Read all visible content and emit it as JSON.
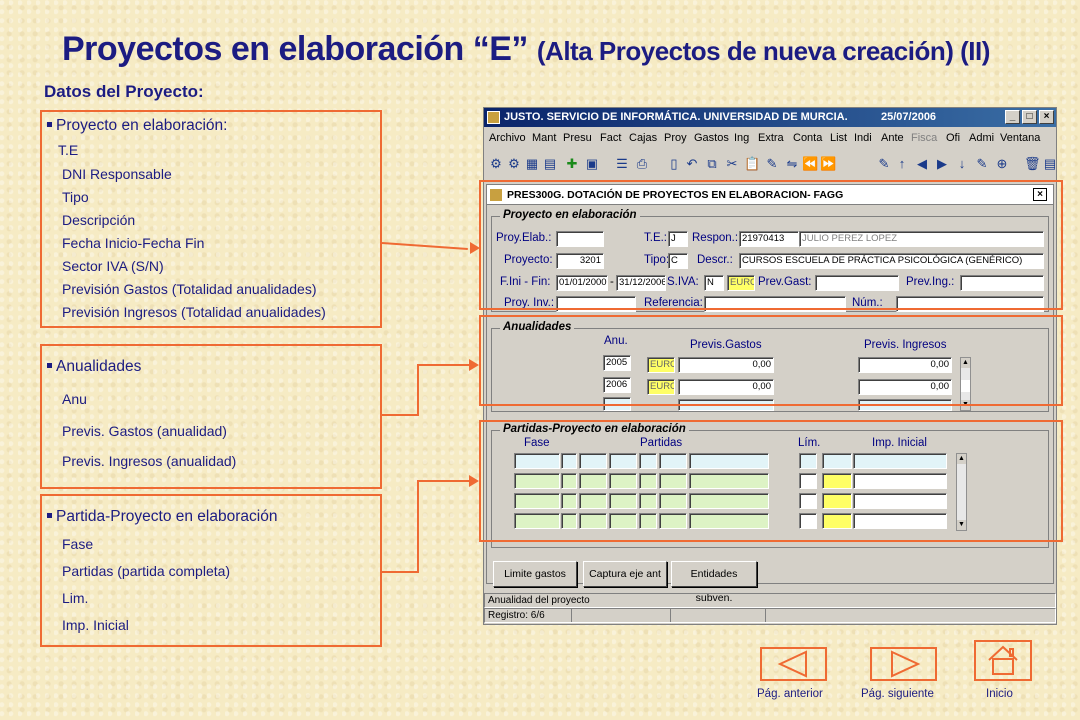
{
  "slide": {
    "title_main": "Proyectos en elaboración “E”",
    "title_sub": "(Alta Proyectos de nueva creación) (II)",
    "section": "Datos del Proyecto:"
  },
  "box1": {
    "heading": "Proyecto en elaboración:",
    "items": [
      "T.E",
      "DNI Responsable",
      "Tipo",
      "Descripción",
      "Fecha Inicio-Fecha Fin",
      "Sector IVA (S/N)",
      "Previsión Gastos (Totalidad anualidades)",
      "Previsión Ingresos (Totalidad anualidades)"
    ]
  },
  "box2": {
    "heading": "Anualidades",
    "items": [
      "Anu",
      "Previs. Gastos (anualidad)",
      "Previs. Ingresos (anualidad)"
    ]
  },
  "box3": {
    "heading": "Partida-Proyecto en elaboración",
    "items": [
      "Fase",
      "Partidas (partida completa)",
      "Lim.",
      "Imp. Inicial"
    ]
  },
  "app": {
    "title": "JUSTO. SERVICIO DE INFORMÁTICA. UNIVERSIDAD DE MURCIA.",
    "date": "25/07/2006",
    "window_buttons": [
      "_",
      "□",
      "×"
    ],
    "menu": [
      "Archivo",
      "Mant",
      "Presu",
      "Fact",
      "Cajas",
      "Proy",
      "Gastos",
      "Ing",
      "Extra",
      "Conta",
      "List",
      "Indi",
      "Ante",
      "Fisca",
      "Ofi",
      "Admi",
      "Ventana"
    ],
    "form_title": "PRES300G. DOTACIÓN DE PROYECTOS EN ELABORACION- FAGG",
    "close": "×",
    "group1": {
      "title": "Proyecto en elaboración",
      "proy_elab_label": "Proy.Elab.:",
      "te_label": "T.E.:",
      "te_value": "J",
      "respon_label": "Respon.:",
      "respon_dni": "21970413",
      "respon_name": "JULIO PEREZ LOPEZ",
      "proyecto_label": "Proyecto:",
      "proyecto_value": "3201",
      "tipo_label": "Tipo:",
      "tipo_value": "C",
      "descr_label": "Descr.:",
      "descr_value": "CURSOS ESCUELA DE PRÁCTICA PSICOLÓGICA (GENÉRICO)",
      "fini_label": "F.Ini - Fin:",
      "fini_value": "01/01/2000",
      "dash": "-",
      "ffin_value": "31/12/2006",
      "siva_label": "S.IVA:",
      "siva_value": "N",
      "currency": "EURO",
      "prevgast_label": "Prev.Gast:",
      "prevgast_value": "",
      "preving_label": "Prev.Ing.:",
      "preving_value": "",
      "proyinv_label": "Proy. Inv.:",
      "proyinv_value": "",
      "referencia_label": "Referencia:",
      "referencia_value": "",
      "num_label": "Núm.:",
      "num_value": ""
    },
    "group2": {
      "title": "Anualidades",
      "col_anu": "Anu.",
      "col_gastos": "Previs.Gastos",
      "col_ingresos": "Previs. Ingresos",
      "rows": [
        {
          "anu": "2005",
          "cur": "EURO",
          "gastos": "0,00",
          "ingresos": "0,00"
        },
        {
          "anu": "2006",
          "cur": "EURO",
          "gastos": "0,00",
          "ingresos": "0,00"
        },
        {
          "anu": "",
          "cur": "",
          "gastos": "",
          "ingresos": ""
        }
      ]
    },
    "group3": {
      "title": "Partidas-Proyecto en elaboración",
      "col_fase": "Fase",
      "col_partidas": "Partidas",
      "col_lim": "Lím.",
      "col_imp": "Imp. Inicial"
    },
    "buttons": {
      "limite": "Limite gastos",
      "captura": "Captura eje ant",
      "entidades": "Entidades subven."
    },
    "status1": "Anualidad del proyecto",
    "status2": "Registro: 6/6"
  },
  "nav": {
    "prev": "Pág. anterior",
    "next": "Pág. siguiente",
    "home": "Inicio"
  }
}
